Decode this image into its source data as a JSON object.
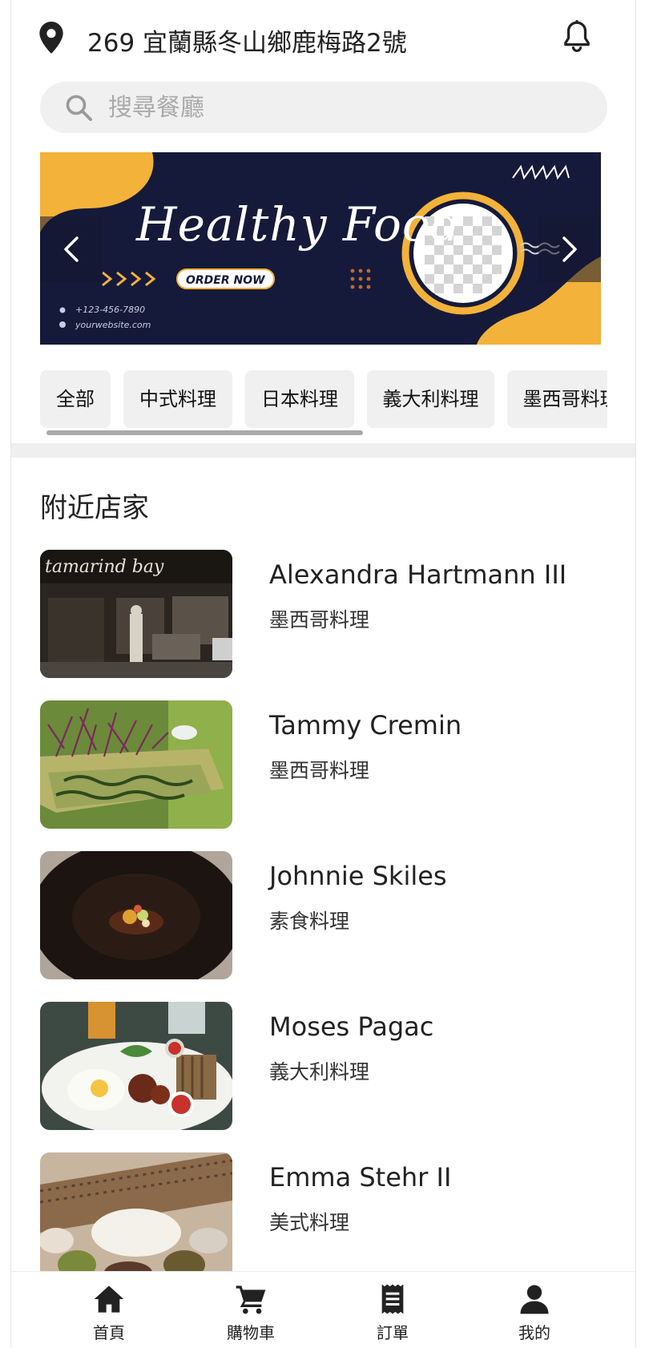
{
  "header": {
    "address": "269 宜蘭縣冬山鄉鹿梅路2號",
    "location_icon": "map-pin-icon",
    "notification_icon": "bell-icon"
  },
  "search": {
    "placeholder": "搜尋餐廳",
    "value": "",
    "icon": "search-icon"
  },
  "banner": {
    "title": "Healthy Food",
    "button_label": "ORDER NOW",
    "phone": "+123-456-7890",
    "website": "yourwebsite.com",
    "colors": {
      "background": "#151a3a",
      "accent": "#f3b23a"
    }
  },
  "categories": [
    {
      "label": "全部"
    },
    {
      "label": "中式料理"
    },
    {
      "label": "日本料理"
    },
    {
      "label": "義大利料理"
    },
    {
      "label": "墨西哥料理"
    }
  ],
  "nearby": {
    "title": "附近店家",
    "stores": [
      {
        "name": "Alexandra Hartmann III",
        "cuisine": "墨西哥料理",
        "photo_sign": "tamarind bay"
      },
      {
        "name": "Tammy Cremin",
        "cuisine": "墨西哥料理"
      },
      {
        "name": "Johnnie Skiles",
        "cuisine": "素食料理"
      },
      {
        "name": "Moses Pagac",
        "cuisine": "義大利料理"
      },
      {
        "name": "Emma Stehr II",
        "cuisine": "美式料理"
      }
    ]
  },
  "bottom_nav": [
    {
      "label": "首頁",
      "icon": "home-icon"
    },
    {
      "label": "購物車",
      "icon": "cart-icon"
    },
    {
      "label": "訂單",
      "icon": "receipt-icon"
    },
    {
      "label": "我的",
      "icon": "user-icon"
    }
  ]
}
